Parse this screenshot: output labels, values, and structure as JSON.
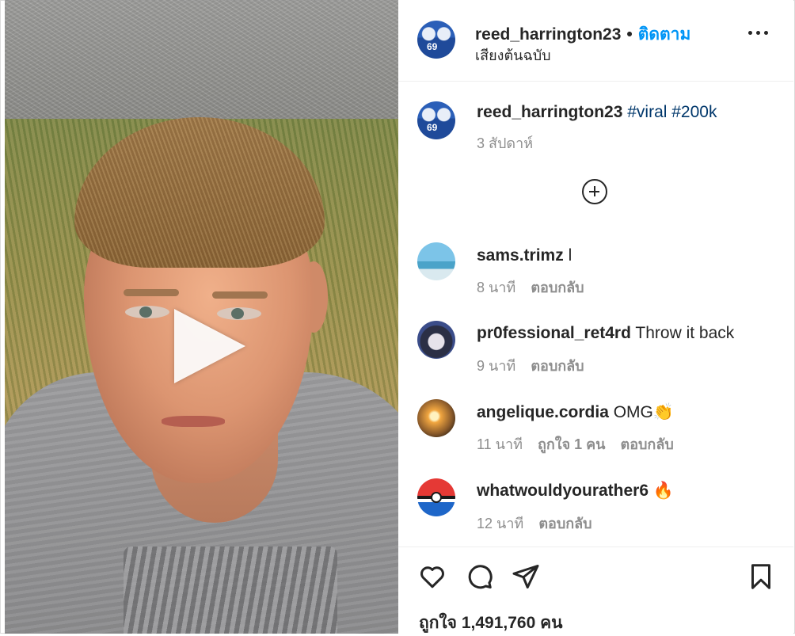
{
  "post": {
    "username": "reed_harrington23",
    "follow_label": "ติดตาม",
    "audio_label": "เสียงต้นฉบับ",
    "separator": "•"
  },
  "caption": {
    "username": "reed_harrington23",
    "hashtags": "#viral #200k",
    "time": "3 สัปดาห์"
  },
  "comments": [
    {
      "username": "sams.trimz",
      "text": "l",
      "time": "8 นาที",
      "likes": "",
      "reply": "ตอบกลับ"
    },
    {
      "username": "pr0fessional_ret4rd",
      "text": "Throw it back",
      "time": "9 นาที",
      "likes": "",
      "reply": "ตอบกลับ"
    },
    {
      "username": "angelique.cordia",
      "text": "OMG👏",
      "time": "11 นาที",
      "likes": "ถูกใจ 1 คน",
      "reply": "ตอบกลับ"
    },
    {
      "username": "whatwouldyourather6",
      "text": "🔥",
      "time": "12 นาที",
      "likes": "",
      "reply": "ตอบกลับ"
    }
  ],
  "actions": {
    "like_icon": "heart-icon",
    "comment_icon": "comment-bubble-icon",
    "share_icon": "paper-plane-icon",
    "save_icon": "bookmark-icon"
  },
  "likes_text": "ถูกใจ 1,491,760 คน",
  "colors": {
    "link_blue": "#0095f6",
    "hashtag_blue": "#00376b",
    "secondary_text": "#8e8e8e"
  }
}
